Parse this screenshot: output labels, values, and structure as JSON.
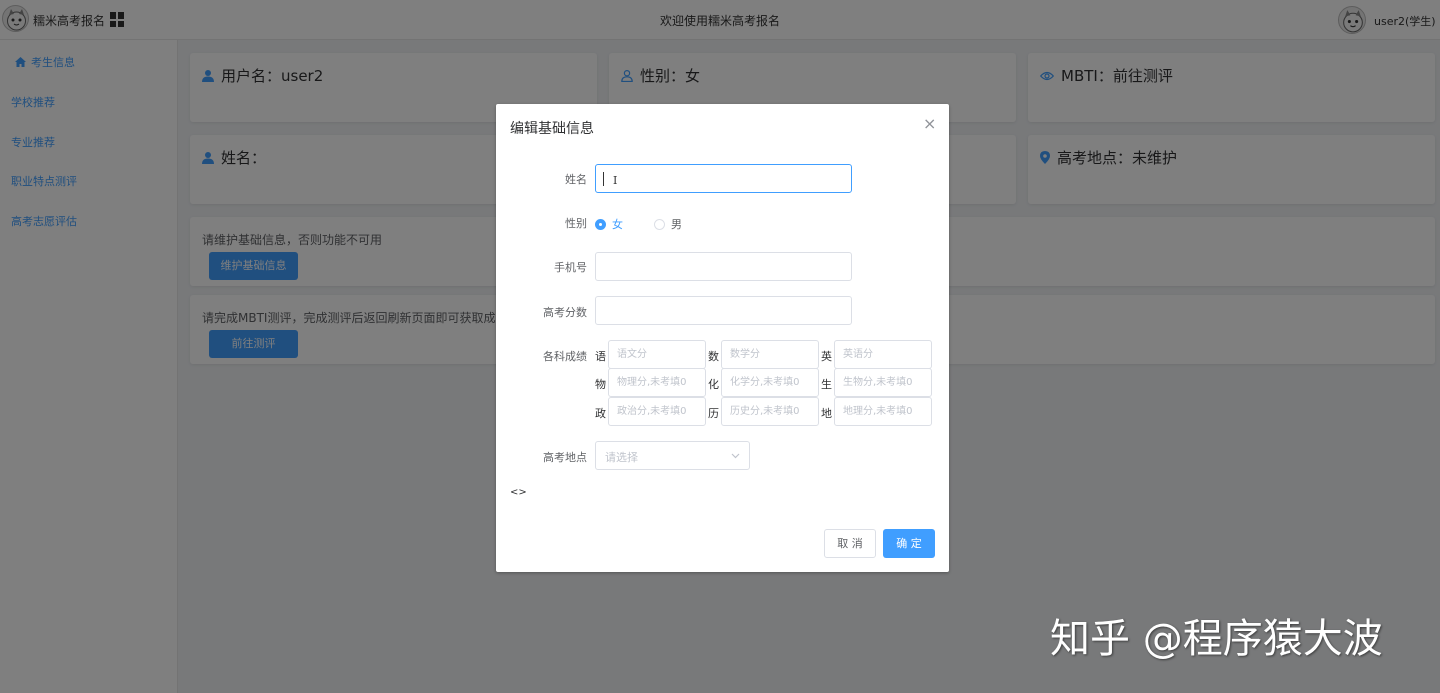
{
  "header": {
    "brand": "糯米高考报名",
    "welcome": "欢迎使用糯米高考报名",
    "user": "user2(学生)"
  },
  "sidebar": {
    "items": [
      {
        "label": "考生信息",
        "icon": "home-icon",
        "active": true
      },
      {
        "label": "学校推荐"
      },
      {
        "label": "专业推荐"
      },
      {
        "label": "职业特点测评"
      },
      {
        "label": "高考志愿评估"
      }
    ]
  },
  "cards": {
    "username": "用户名：user2",
    "gender": "性别：女",
    "mbti": "MBTI：前往测评",
    "name": "姓名：",
    "location": "高考地点：未维护",
    "notice_basic": "请维护基础信息，否则功能不可用",
    "btn_basic": "维护基础信息",
    "notice_mbti": "请完成MBTI测评，完成测评后返回刷新页面即可获取成绩",
    "btn_mbti": "前往测评"
  },
  "dialog": {
    "title": "编辑基础信息",
    "close": "×",
    "fields": {
      "name_label": "姓名",
      "name_value": "",
      "gender_label": "性别",
      "gender_options": [
        "女",
        "男"
      ],
      "gender_selected": "女",
      "phone_label": "手机号",
      "score_label": "高考分数",
      "subjects_label": "各科成绩",
      "location_label": "高考地点",
      "location_placeholder": "请选择"
    },
    "subjects": [
      {
        "label": "语",
        "placeholder": "语文分"
      },
      {
        "label": "数",
        "placeholder": "数学分"
      },
      {
        "label": "英",
        "placeholder": "英语分"
      },
      {
        "label": "物",
        "placeholder": "物理分,未考填0"
      },
      {
        "label": "化",
        "placeholder": "化学分,未考填0"
      },
      {
        "label": "生",
        "placeholder": "生物分,未考填0"
      },
      {
        "label": "政",
        "placeholder": "政治分,未考填0"
      },
      {
        "label": "历",
        "placeholder": "历史分,未考填0"
      },
      {
        "label": "地",
        "placeholder": "地理分,未考填0"
      }
    ],
    "code_tag": "<>",
    "cancel": "取 消",
    "ok": "确 定"
  },
  "watermark": "知乎 @程序猿大波",
  "colors": {
    "primary": "#409eff",
    "overlay": "rgba(0,0,0,0.5)"
  }
}
